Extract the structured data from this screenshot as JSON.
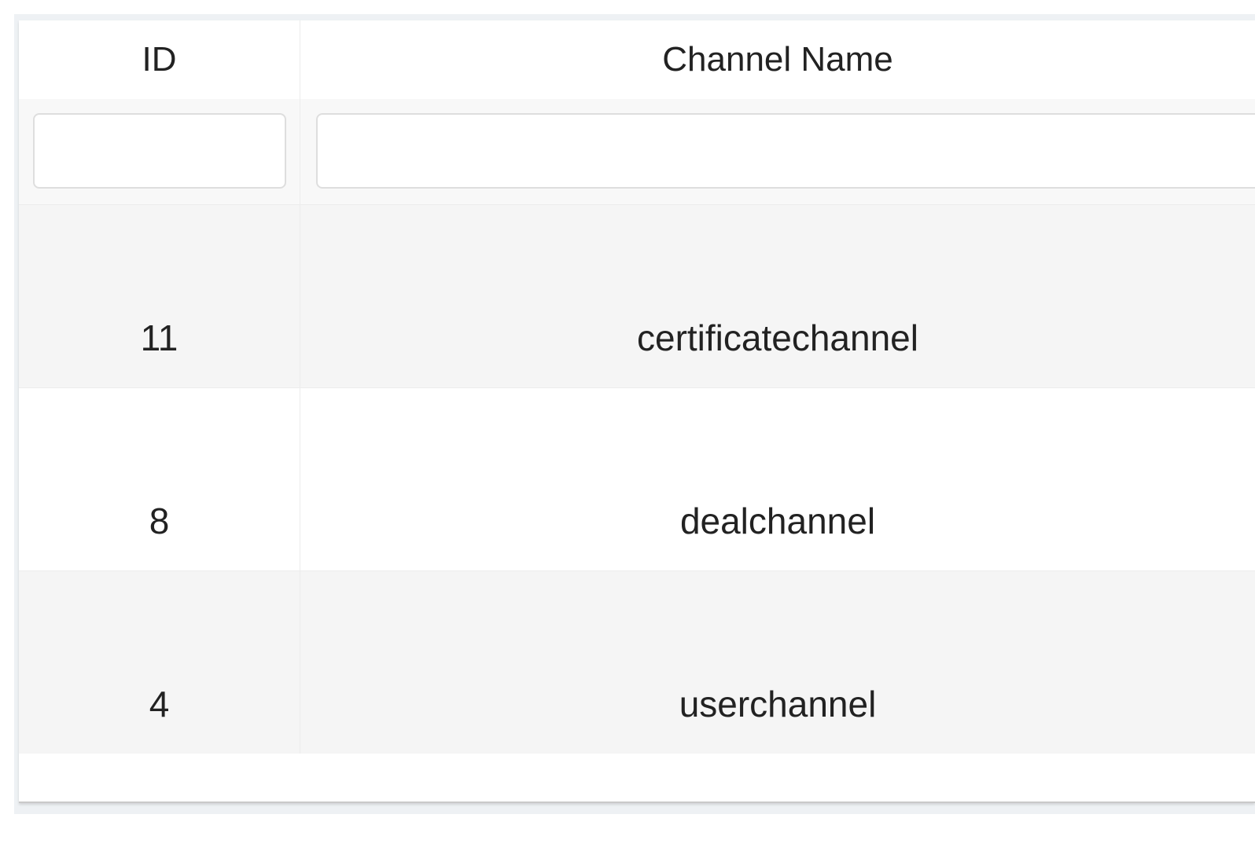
{
  "table": {
    "columns": [
      {
        "key": "id",
        "label": "ID"
      },
      {
        "key": "name",
        "label": "Channel Name"
      }
    ],
    "filters": {
      "id_value": "",
      "name_value": ""
    },
    "rows": [
      {
        "id": "11",
        "name": "certificatechannel"
      },
      {
        "id": "8",
        "name": "dealchannel"
      },
      {
        "id": "4",
        "name": "userchannel"
      }
    ]
  },
  "colors": {
    "row_alt": "#f5f5f5",
    "border": "#ececec",
    "text": "#222222"
  }
}
